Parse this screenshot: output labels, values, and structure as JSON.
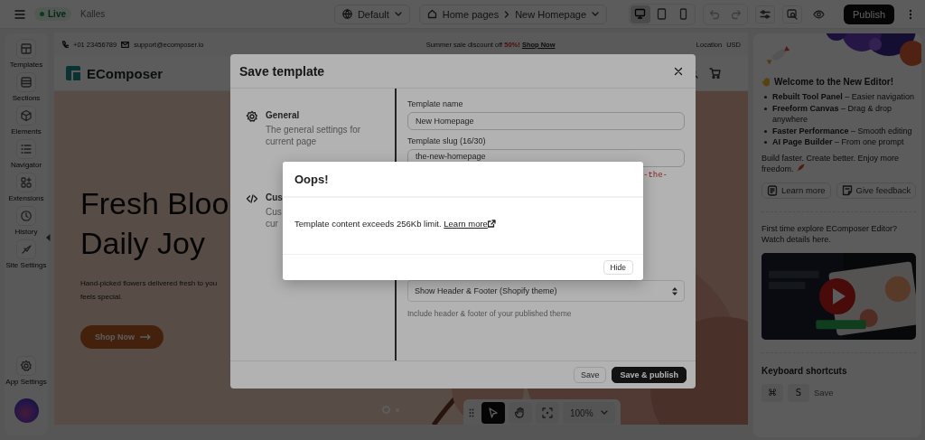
{
  "top_bar": {
    "status_badge": "Live",
    "store_name": "Kalles",
    "theme_selector": "Default",
    "breadcrumb": [
      "Home pages",
      "New Homepage"
    ],
    "devices": [
      {
        "kind": "desktop",
        "selected": true
      },
      {
        "kind": "tablet",
        "selected": false
      },
      {
        "kind": "mobile",
        "selected": false
      }
    ],
    "publish_button": "Publish"
  },
  "sidebar": {
    "items": [
      {
        "kind": "templates",
        "label": "Templates"
      },
      {
        "kind": "sections",
        "label": "Sections"
      },
      {
        "kind": "elements",
        "label": "Elements"
      },
      {
        "kind": "navigator",
        "label": "Navigator"
      },
      {
        "kind": "extensions",
        "label": "Extensions"
      },
      {
        "kind": "history",
        "label": "History"
      },
      {
        "kind": "site",
        "label": "Site Settings"
      }
    ],
    "footer_item": {
      "kind": "settings",
      "label": "App Settings"
    }
  },
  "canvas": {
    "top_strip": {
      "phone": "+01 23456789",
      "email": "support@ecomposer.io",
      "promo_text": "Summer sale discount off",
      "promo_highlight": "50%!",
      "promo_link": "Shop Now",
      "location": "Location",
      "currency": "USD"
    },
    "logo": "EComposer",
    "hero": {
      "title_lines": [
        "Fresh Bloo",
        "Daily Joy"
      ],
      "subtitle_lines": [
        "Hand-picked flowers delivered fresh to you",
        "feels special."
      ],
      "button": "Shop Now"
    },
    "slides": [
      {
        "selected": true
      },
      {
        "selected": false
      }
    ],
    "toolbar": {
      "tools": [
        {
          "kind": "pointer",
          "selected": true
        },
        {
          "kind": "hand",
          "selected": false
        },
        {
          "kind": "focus",
          "selected": false
        }
      ],
      "zoom": "100%"
    }
  },
  "save_template_dialog": {
    "title": "Save template",
    "sections": [
      {
        "kind": "general",
        "title": "General",
        "description_lines": [
          "The general settings for",
          "current page"
        ]
      },
      {
        "kind": "code",
        "title": "Cus",
        "description_lines": [
          "Cus",
          "cur"
        ]
      }
    ],
    "name_label": "Template name",
    "name_value": "New Homepage",
    "slug_label": "Template slug (16/30)",
    "slug_value": "the-new-homepage",
    "slug_preview": "-the-",
    "layout_select": "Show Header & Footer (Shopify theme)",
    "layout_help": "Include header & footer of your published theme",
    "buttons": [
      {
        "kind": "secondary",
        "label": "Save"
      },
      {
        "kind": "primary",
        "label": "Save & publish"
      }
    ]
  },
  "error_dialog": {
    "title": "Oops!",
    "message": "Template content exceeds 256Kb limit.",
    "link": "Learn more",
    "button": "Hide"
  },
  "right_panel": {
    "welcome_title": "Welcome to the New Editor!",
    "features": [
      "**Rebuilt Tool Panel** – Easier navigation",
      "**Freeform Canvas** – Drag & drop anywhere",
      "**Faster Performance** – Smooth editing",
      "**AI Page Builder** – From one prompt"
    ],
    "tagline": "Build faster. Create better. Enjoy more freedom.",
    "buttons": [
      {
        "kind": "doc",
        "label": "Learn more"
      },
      {
        "kind": "feedback",
        "label": "Give feedback"
      }
    ],
    "video_intro": "First time explore EComposer Editor? Watch details here.",
    "shortcuts_title": "Keyboard shortcuts",
    "shortcuts": [
      {
        "keys": [
          "⌘",
          "S"
        ],
        "action": "Save"
      }
    ]
  }
}
